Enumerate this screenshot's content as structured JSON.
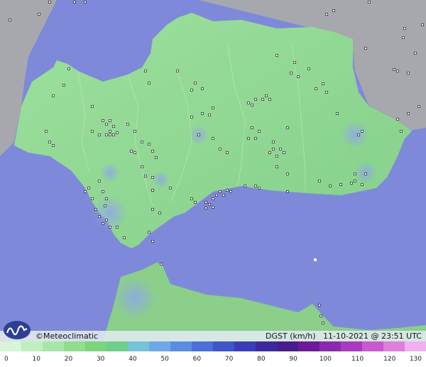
{
  "brand": {
    "logo_icon": "meteoclimatic-logo-icon",
    "credit": "©Meteoclimatic"
  },
  "map_info": {
    "variable": "DGST (km/h)",
    "timestamp": "11-10-2021 @ 23:51 UTC",
    "text": "DGST (km/h)   11-10-2021 @ 23:51 UTC"
  },
  "colors": {
    "sea": "#7f89d9",
    "land_other": "#a8a8b0",
    "region": "#8fd98f",
    "calm_blue": "#9fb3e8"
  },
  "legend": {
    "ticks": [
      "0",
      "10",
      "20",
      "30",
      "40",
      "50",
      "60",
      "70",
      "80",
      "90",
      "100",
      "110",
      "120",
      "130"
    ],
    "colors": [
      "#d8f5d8",
      "#c0eec0",
      "#a8e6a8",
      "#8fdd8f",
      "#7cd47c",
      "#6fcf8a",
      "#78c2d9",
      "#6fa8e6",
      "#5b8de0",
      "#4a6fd6",
      "#3f55c8",
      "#3a3db5",
      "#3a2a9e",
      "#4a1d8c",
      "#6a1a9a",
      "#8a2aaf",
      "#a83ac0",
      "#c85ad0",
      "#dc80dc",
      "#f0b0f0"
    ]
  }
}
